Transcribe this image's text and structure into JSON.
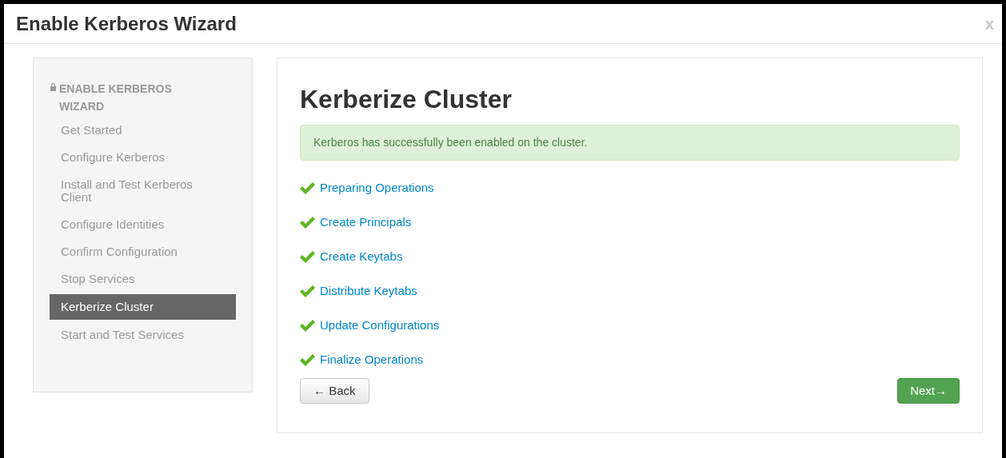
{
  "window": {
    "title": "Enable Kerberos Wizard",
    "close": "x"
  },
  "sidebar": {
    "heading": "ENABLE KERBEROS WIZARD",
    "items": [
      {
        "label": "Get Started",
        "selected": false
      },
      {
        "label": "Configure Kerberos",
        "selected": false
      },
      {
        "label": "Install and Test Kerberos Client",
        "selected": false
      },
      {
        "label": "Configure Identities",
        "selected": false
      },
      {
        "label": "Confirm Configuration",
        "selected": false
      },
      {
        "label": "Stop Services",
        "selected": false
      },
      {
        "label": "Kerberize Cluster",
        "selected": true
      },
      {
        "label": "Start and Test Services",
        "selected": false
      }
    ]
  },
  "main": {
    "title": "Kerberize Cluster",
    "alert": "Kerberos has successfully been enabled on the cluster.",
    "steps": [
      {
        "label": "Preparing Operations",
        "done": true
      },
      {
        "label": "Create Principals",
        "done": true
      },
      {
        "label": "Create Keytabs",
        "done": true
      },
      {
        "label": "Distribute Keytabs",
        "done": true
      },
      {
        "label": "Update Configurations",
        "done": true
      },
      {
        "label": "Finalize Operations",
        "done": true
      }
    ],
    "back_button": "← Back",
    "next_button": "Next→"
  }
}
